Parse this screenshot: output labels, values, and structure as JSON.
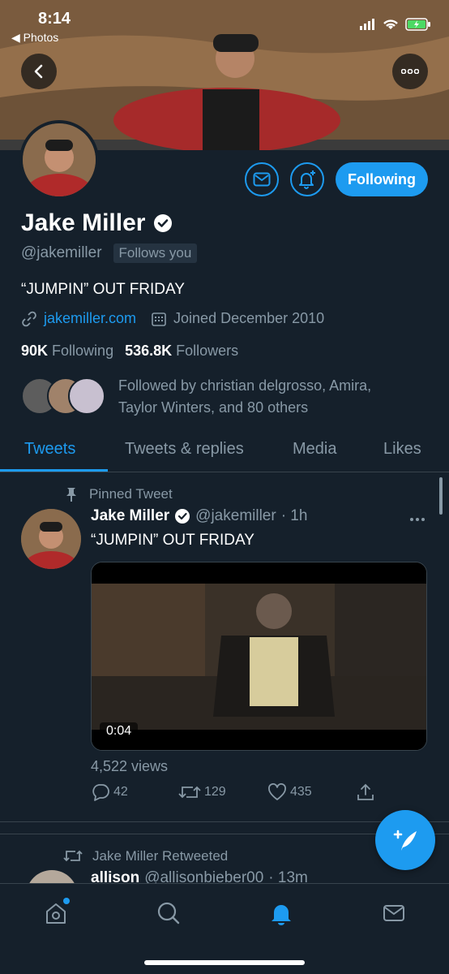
{
  "status_bar": {
    "time": "8:14",
    "back_label": "◀ Photos"
  },
  "colors": {
    "accent": "#1d9bf0",
    "background": "#15202b",
    "muted": "#8899a6",
    "border": "#38444d"
  },
  "profile": {
    "name": "Jake Miller",
    "handle": "@jakemiller",
    "follows_you": "Follows you",
    "bio": "“JUMPIN” OUT FRIDAY",
    "website": "jakemiller.com",
    "joined": "Joined December 2010",
    "following_count": "90K",
    "following_label": "Following",
    "followers_count": "536.8K",
    "followers_label": "Followers",
    "followed_by": "Followed by christian delgrosso, Amira, Taylor Winters, and 80 others",
    "follow_button": "Following"
  },
  "tabs": [
    {
      "label": "Tweets",
      "active": true
    },
    {
      "label": "Tweets & replies",
      "active": false
    },
    {
      "label": "Media",
      "active": false
    },
    {
      "label": "Likes",
      "active": false
    }
  ],
  "pinned_tweet": {
    "pinned_label": "Pinned Tweet",
    "author": "Jake Miller",
    "handle": "@jakemiller",
    "time": "· 1h",
    "text": "“JUMPIN” OUT FRIDAY",
    "video_duration": "0:04",
    "views": "4,522 views",
    "replies": "42",
    "retweets": "129",
    "likes": "435"
  },
  "next_tweet": {
    "retweeted_label": "Jake Miller Retweeted",
    "author": "allison",
    "handle": "@allisonbieber00",
    "time": "· 13m"
  },
  "icons": {
    "back": "chevron-left-icon",
    "more": "more-icon",
    "message": "envelope-icon",
    "notify": "bell-plus-icon",
    "verified": "verified-badge-icon",
    "link": "link-icon",
    "calendar": "calendar-icon",
    "pin": "pin-icon",
    "reply": "reply-icon",
    "retweet": "retweet-icon",
    "like": "heart-icon",
    "share": "share-icon",
    "compose": "compose-tweet-icon",
    "nav": [
      "home-icon",
      "search-icon",
      "notifications-icon",
      "messages-icon"
    ]
  }
}
